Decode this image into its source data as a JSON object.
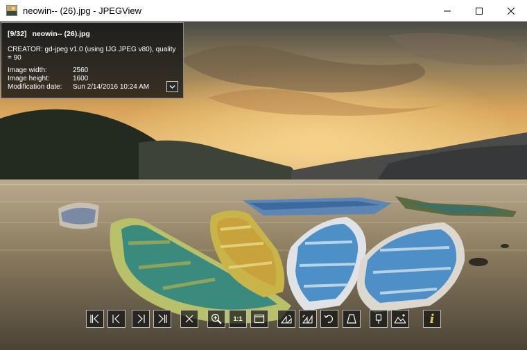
{
  "window": {
    "title": "neowin-- (26).jpg - JPEGView",
    "controls": [
      "minimize",
      "maximize",
      "close"
    ]
  },
  "info_panel": {
    "index": "[9/32]",
    "filename": "neowin-- (26).jpg",
    "creator": "CREATOR: gd-jpeg v1.0 (using IJG JPEG v80), quality = 90",
    "rows": [
      {
        "label": "Image width:",
        "value": "2560"
      },
      {
        "label": "Image height:",
        "value": "1600"
      },
      {
        "label": "Modification date:",
        "value": "Sun 2/14/2016 10:24 AM"
      }
    ]
  },
  "toolbar": {
    "actual_size_label": "1:1",
    "info_label": "i",
    "buttons": [
      {
        "icon": "first-image-icon"
      },
      {
        "icon": "previous-image-icon"
      },
      {
        "icon": "next-image-icon"
      },
      {
        "icon": "last-image-icon"
      },
      {
        "icon": "close-image-icon"
      },
      {
        "icon": "zoom-icon"
      },
      {
        "icon": "actual-size-icon"
      },
      {
        "icon": "fit-window-icon"
      },
      {
        "icon": "rotate-left-icon"
      },
      {
        "icon": "rotate-right-icon"
      },
      {
        "icon": "free-rotate-icon"
      },
      {
        "icon": "perspective-icon"
      },
      {
        "icon": "keep-params-icon"
      },
      {
        "icon": "landscape-enhance-icon"
      },
      {
        "icon": "info-icon"
      }
    ]
  },
  "colors": {
    "titlebar_bg": "#ffffff",
    "panel_bg": "#121212",
    "panel_border": "#8a8a8a",
    "info_accent": "#e8c66a"
  }
}
